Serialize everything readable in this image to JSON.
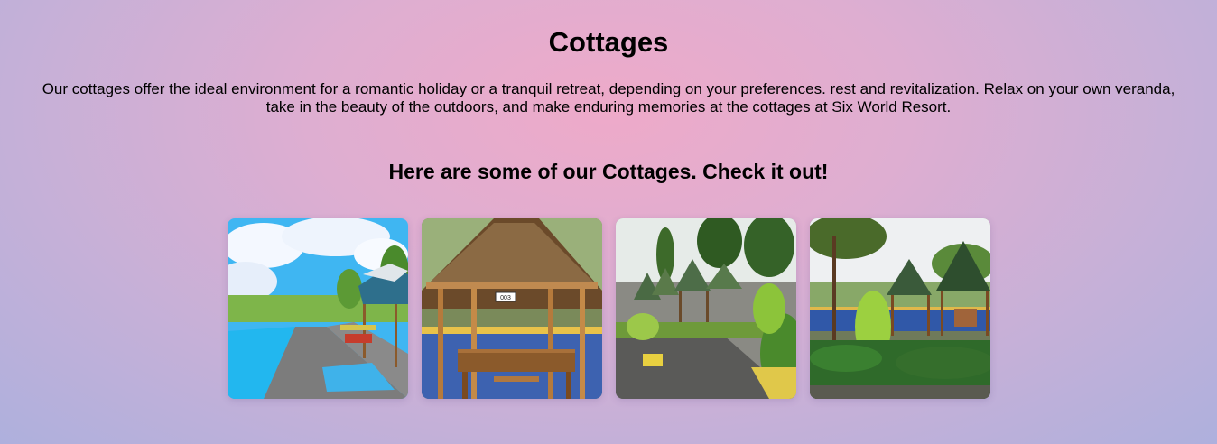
{
  "section": {
    "title": "Cottages",
    "description": "Our cottages offer the ideal environment for a romantic holiday or a tranquil retreat, depending on your preferences. rest and revitalization. Relax on your own veranda, take in the beauty of the outdoors, and make enduring memories at the cottages at Six World Resort.",
    "gallery_heading": "Here are some of our Cottages. Check it out!"
  },
  "gallery": {
    "photos": [
      {
        "name": "poolside-cottages-photo"
      },
      {
        "name": "bamboo-hut-003-photo",
        "sign": "003"
      },
      {
        "name": "garden-cottage-row-photo"
      },
      {
        "name": "lawn-cottages-photo"
      }
    ]
  }
}
